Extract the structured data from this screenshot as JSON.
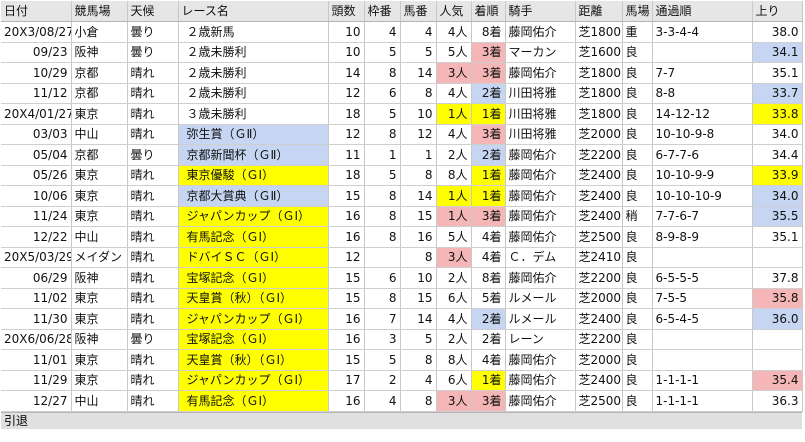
{
  "headers": [
    "日付",
    "競馬場",
    "天候",
    "レース名",
    "頭数",
    "枠番",
    "馬番",
    "人気",
    "着順",
    "騎手",
    "距離",
    "馬場",
    "通過順",
    "上り"
  ],
  "rows": [
    {
      "date": "20X3/08/27",
      "course": "小倉",
      "weather": "曇り",
      "race": "２歳新馬",
      "race_hl": "",
      "runners": "10",
      "gate": "4",
      "num": "4",
      "pop": "4人",
      "pop_hl": "",
      "finish": "8着",
      "fin_hl": "",
      "jockey": "藤岡佑介",
      "dist": "芝1800",
      "track": "重",
      "passing": "3-3-4-4",
      "up": "38.0",
      "up_hl": ""
    },
    {
      "date": "09/23",
      "course": "阪神",
      "weather": "曇り",
      "race": "２歳未勝利",
      "race_hl": "",
      "runners": "10",
      "gate": "5",
      "num": "5",
      "pop": "5人",
      "pop_hl": "",
      "finish": "3着",
      "fin_hl": "pink",
      "jockey": "マーカン",
      "dist": "芝1600",
      "track": "良",
      "passing": "",
      "up": "34.1",
      "up_hl": "blue"
    },
    {
      "date": "10/29",
      "course": "京都",
      "weather": "晴れ",
      "race": "２歳未勝利",
      "race_hl": "",
      "runners": "14",
      "gate": "8",
      "num": "14",
      "pop": "3人",
      "pop_hl": "pink",
      "finish": "3着",
      "fin_hl": "pink",
      "jockey": "藤岡佑介",
      "dist": "芝1800",
      "track": "良",
      "passing": "7-7",
      "up": "35.1",
      "up_hl": ""
    },
    {
      "date": "11/12",
      "course": "京都",
      "weather": "晴れ",
      "race": "２歳未勝利",
      "race_hl": "",
      "runners": "12",
      "gate": "6",
      "num": "8",
      "pop": "4人",
      "pop_hl": "",
      "finish": "2着",
      "fin_hl": "blue",
      "jockey": "川田将雅",
      "dist": "芝1800",
      "track": "良",
      "passing": "8-8",
      "up": "33.7",
      "up_hl": "blue"
    },
    {
      "date": "20X4/01/27",
      "course": "東京",
      "weather": "晴れ",
      "race": "３歳未勝利",
      "race_hl": "",
      "runners": "18",
      "gate": "5",
      "num": "10",
      "pop": "1人",
      "pop_hl": "yellow",
      "finish": "1着",
      "fin_hl": "yellow",
      "jockey": "川田将雅",
      "dist": "芝1800",
      "track": "良",
      "passing": "14-12-12",
      "up": "33.8",
      "up_hl": "yellow"
    },
    {
      "date": "03/03",
      "course": "中山",
      "weather": "晴れ",
      "race": "弥生賞（ＧⅡ）",
      "race_hl": "blue",
      "runners": "12",
      "gate": "8",
      "num": "12",
      "pop": "4人",
      "pop_hl": "",
      "finish": "3着",
      "fin_hl": "pink",
      "jockey": "川田将雅",
      "dist": "芝2000",
      "track": "良",
      "passing": "10-10-9-8",
      "up": "34.0",
      "up_hl": ""
    },
    {
      "date": "05/04",
      "course": "京都",
      "weather": "曇り",
      "race": "京都新聞杯（ＧⅡ）",
      "race_hl": "blue",
      "runners": "11",
      "gate": "1",
      "num": "1",
      "pop": "2人",
      "pop_hl": "",
      "finish": "2着",
      "fin_hl": "blue",
      "jockey": "藤岡佑介",
      "dist": "芝2200",
      "track": "良",
      "passing": "6-7-7-6",
      "up": "34.4",
      "up_hl": ""
    },
    {
      "date": "05/26",
      "course": "東京",
      "weather": "晴れ",
      "race": "東京優駿（ＧⅠ）",
      "race_hl": "yellow",
      "runners": "18",
      "gate": "5",
      "num": "8",
      "pop": "8人",
      "pop_hl": "",
      "finish": "1着",
      "fin_hl": "yellow",
      "jockey": "藤岡佑介",
      "dist": "芝2400",
      "track": "良",
      "passing": "10-10-9-9",
      "up": "33.9",
      "up_hl": "yellow"
    },
    {
      "date": "10/06",
      "course": "東京",
      "weather": "晴れ",
      "race": "京都大賞典（ＧⅡ）",
      "race_hl": "blue",
      "runners": "15",
      "gate": "8",
      "num": "14",
      "pop": "1人",
      "pop_hl": "yellow",
      "finish": "1着",
      "fin_hl": "yellow",
      "jockey": "藤岡佑介",
      "dist": "芝2400",
      "track": "良",
      "passing": "10-10-10-9",
      "up": "34.0",
      "up_hl": "blue"
    },
    {
      "date": "11/24",
      "course": "東京",
      "weather": "晴れ",
      "race": "ジャパンカップ（ＧⅠ）",
      "race_hl": "yellow",
      "runners": "16",
      "gate": "8",
      "num": "15",
      "pop": "1人",
      "pop_hl": "pink",
      "finish": "3着",
      "fin_hl": "pink",
      "jockey": "藤岡佑介",
      "dist": "芝2400",
      "track": "稍",
      "passing": "7-7-6-7",
      "up": "35.5",
      "up_hl": "blue"
    },
    {
      "date": "12/22",
      "course": "中山",
      "weather": "晴れ",
      "race": "有馬記念（ＧⅠ）",
      "race_hl": "yellow",
      "runners": "16",
      "gate": "8",
      "num": "16",
      "pop": "5人",
      "pop_hl": "",
      "finish": "4着",
      "fin_hl": "",
      "jockey": "藤岡佑介",
      "dist": "芝2500",
      "track": "良",
      "passing": "8-9-8-9",
      "up": "35.1",
      "up_hl": ""
    },
    {
      "date": "20X5/03/29",
      "course": "メイダン",
      "weather": "晴れ",
      "race": "ドバイＳＣ（ＧⅠ）",
      "race_hl": "yellow",
      "runners": "12",
      "gate": "",
      "num": "8",
      "pop": "3人",
      "pop_hl": "pink",
      "finish": "4着",
      "fin_hl": "",
      "jockey": "Ｃ．デム",
      "dist": "芝2410",
      "track": "良",
      "passing": "",
      "up": "",
      "up_hl": ""
    },
    {
      "date": "06/29",
      "course": "阪神",
      "weather": "晴れ",
      "race": "宝塚記念（ＧⅠ）",
      "race_hl": "yellow",
      "runners": "15",
      "gate": "6",
      "num": "10",
      "pop": "2人",
      "pop_hl": "",
      "finish": "8着",
      "fin_hl": "",
      "jockey": "藤岡佑介",
      "dist": "芝2200",
      "track": "良",
      "passing": "6-5-5-5",
      "up": "37.8",
      "up_hl": ""
    },
    {
      "date": "11/02",
      "course": "東京",
      "weather": "晴れ",
      "race": "天皇賞（秋）（ＧⅠ）",
      "race_hl": "yellow",
      "runners": "15",
      "gate": "8",
      "num": "15",
      "pop": "6人",
      "pop_hl": "",
      "finish": "5着",
      "fin_hl": "",
      "jockey": "ルメール",
      "dist": "芝2000",
      "track": "良",
      "passing": "7-5-5",
      "up": "35.8",
      "up_hl": "pink"
    },
    {
      "date": "11/30",
      "course": "東京",
      "weather": "晴れ",
      "race": "ジャパンカップ（ＧⅠ）",
      "race_hl": "yellow",
      "runners": "16",
      "gate": "7",
      "num": "14",
      "pop": "4人",
      "pop_hl": "",
      "finish": "2着",
      "fin_hl": "blue",
      "jockey": "ルメール",
      "dist": "芝2400",
      "track": "良",
      "passing": "6-5-4-5",
      "up": "36.0",
      "up_hl": "blue"
    },
    {
      "date": "20X6/06/28",
      "course": "阪神",
      "weather": "曇り",
      "race": "宝塚記念（ＧⅠ）",
      "race_hl": "yellow",
      "runners": "16",
      "gate": "3",
      "num": "5",
      "pop": "2人",
      "pop_hl": "",
      "finish": "2着",
      "fin_hl": "",
      "jockey": "レーン",
      "dist": "芝2200",
      "track": "良",
      "passing": "",
      "up": "",
      "up_hl": ""
    },
    {
      "date": "11/01",
      "course": "東京",
      "weather": "晴れ",
      "race": "天皇賞（秋）（ＧⅠ）",
      "race_hl": "yellow",
      "runners": "15",
      "gate": "5",
      "num": "8",
      "pop": "8人",
      "pop_hl": "",
      "finish": "4着",
      "fin_hl": "",
      "jockey": "藤岡佑介",
      "dist": "芝2000",
      "track": "良",
      "passing": "",
      "up": "",
      "up_hl": ""
    },
    {
      "date": "11/29",
      "course": "東京",
      "weather": "晴れ",
      "race": "ジャパンカップ（ＧⅠ）",
      "race_hl": "yellow",
      "runners": "17",
      "gate": "2",
      "num": "4",
      "pop": "6人",
      "pop_hl": "",
      "finish": "1着",
      "fin_hl": "yellow",
      "jockey": "藤岡佑介",
      "dist": "芝2400",
      "track": "良",
      "passing": "1-1-1-1",
      "up": "35.4",
      "up_hl": "pink"
    },
    {
      "date": "12/27",
      "course": "中山",
      "weather": "晴れ",
      "race": "有馬記念（ＧⅠ）",
      "race_hl": "yellow",
      "runners": "16",
      "gate": "4",
      "num": "8",
      "pop": "3人",
      "pop_hl": "pink",
      "finish": "3着",
      "fin_hl": "pink",
      "jockey": "藤岡佑介",
      "dist": "芝2500",
      "track": "良",
      "passing": "1-1-1-1",
      "up": "36.3",
      "up_hl": ""
    }
  ],
  "footer": "引退"
}
